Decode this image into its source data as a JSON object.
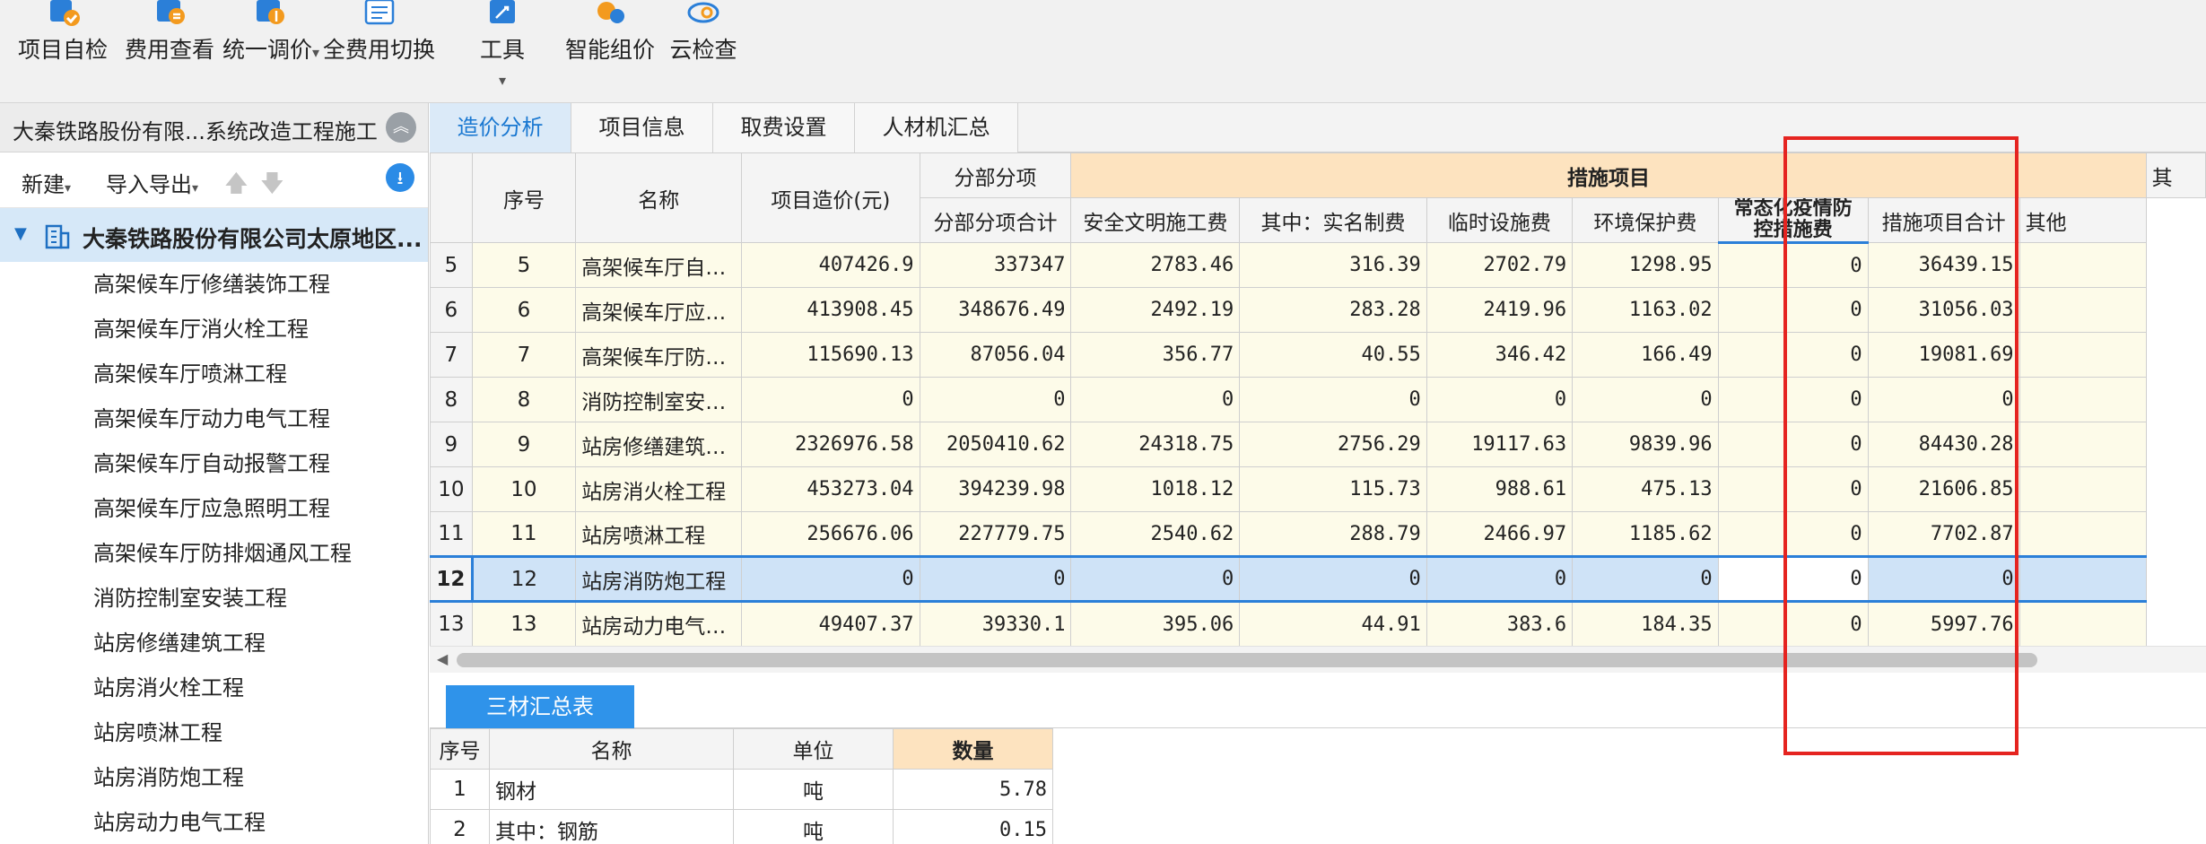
{
  "toolbar": {
    "items": [
      {
        "label": "项目自检",
        "icon": "project-check-icon"
      },
      {
        "label": "费用查看",
        "icon": "cost-view-icon"
      },
      {
        "label": "统一调价",
        "icon": "price-adjust-icon"
      },
      {
        "label": "全费用切换",
        "icon": "full-cost-switch-icon"
      },
      {
        "label": "工具",
        "icon": "tools-icon"
      },
      {
        "label": "智能组价",
        "icon": "smart-pricing-icon"
      },
      {
        "label": "云检查",
        "icon": "cloud-check-icon"
      }
    ]
  },
  "left": {
    "project_title": "大秦铁路股份有限...系统改造工程施工",
    "new_label": "新建",
    "import_export_label": "导入导出",
    "tree_root": "大秦铁路股份有限公司太原地区...",
    "tree_items": [
      "高架候车厅修缮装饰工程",
      "高架候车厅消火栓工程",
      "高架候车厅喷淋工程",
      "高架候车厅动力电气工程",
      "高架候车厅自动报警工程",
      "高架候车厅应急照明工程",
      "高架候车厅防排烟通风工程",
      "消防控制室安装工程",
      "站房修缮建筑工程",
      "站房消火栓工程",
      "站房喷淋工程",
      "站房消防炮工程",
      "站房动力电气工程"
    ]
  },
  "tabs": [
    "造价分析",
    "项目信息",
    "取费设置",
    "人材机汇总"
  ],
  "grid": {
    "headers": {
      "seq": "序号",
      "name": "名称",
      "cost": "项目造价(元)",
      "group_fbfx": "分部分项",
      "group_measures": "措施项目",
      "group_other": "其",
      "fbfx_total": "分部分项合计",
      "safety": "安全文明施工费",
      "realname": "其中：实名制费",
      "temp": "临时设施费",
      "env": "环境保护费",
      "epidemic_line1": "常态化疫情防",
      "epidemic_line2": "控措施费",
      "measures_total": "措施项目合计",
      "other": "其他"
    },
    "rows": [
      {
        "rownum": "5",
        "seq": "5",
        "name": "高架候车厅自…",
        "cost": "407426.9",
        "fbfx": "337347",
        "safety": "2783.46",
        "realname": "316.39",
        "temp": "2702.79",
        "env": "1298.95",
        "epidemic": "0",
        "measures": "36439.15"
      },
      {
        "rownum": "6",
        "seq": "6",
        "name": "高架候车厅应…",
        "cost": "413908.45",
        "fbfx": "348676.49",
        "safety": "2492.19",
        "realname": "283.28",
        "temp": "2419.96",
        "env": "1163.02",
        "epidemic": "0",
        "measures": "31056.03"
      },
      {
        "rownum": "7",
        "seq": "7",
        "name": "高架候车厅防…",
        "cost": "115690.13",
        "fbfx": "87056.04",
        "safety": "356.77",
        "realname": "40.55",
        "temp": "346.42",
        "env": "166.49",
        "epidemic": "0",
        "measures": "19081.69"
      },
      {
        "rownum": "8",
        "seq": "8",
        "name": "消防控制室安…",
        "cost": "0",
        "fbfx": "0",
        "safety": "0",
        "realname": "0",
        "temp": "0",
        "env": "0",
        "epidemic": "0",
        "measures": "0"
      },
      {
        "rownum": "9",
        "seq": "9",
        "name": "站房修缮建筑…",
        "cost": "2326976.58",
        "fbfx": "2050410.62",
        "safety": "24318.75",
        "realname": "2756.29",
        "temp": "19117.63",
        "env": "9839.96",
        "epidemic": "0",
        "measures": "84430.28"
      },
      {
        "rownum": "10",
        "seq": "10",
        "name": "站房消火栓工程",
        "cost": "453273.04",
        "fbfx": "394239.98",
        "safety": "1018.12",
        "realname": "115.73",
        "temp": "988.61",
        "env": "475.13",
        "epidemic": "0",
        "measures": "21606.85"
      },
      {
        "rownum": "11",
        "seq": "11",
        "name": "站房喷淋工程",
        "cost": "256676.06",
        "fbfx": "227779.75",
        "safety": "2540.62",
        "realname": "288.79",
        "temp": "2466.97",
        "env": "1185.62",
        "epidemic": "0",
        "measures": "7702.87"
      },
      {
        "rownum": "12",
        "seq": "12",
        "name": "站房消防炮工程",
        "cost": "0",
        "fbfx": "0",
        "safety": "0",
        "realname": "0",
        "temp": "0",
        "env": "0",
        "epidemic": "0",
        "measures": "0"
      },
      {
        "rownum": "13",
        "seq": "13",
        "name": "站房动力电气…",
        "cost": "49407.37",
        "fbfx": "39330.1",
        "safety": "395.06",
        "realname": "44.91",
        "temp": "383.6",
        "env": "184.35",
        "epidemic": "0",
        "measures": "5997.76"
      }
    ]
  },
  "bottom": {
    "tab_label": "三材汇总表",
    "headers": {
      "seq": "序号",
      "name": "名称",
      "unit": "单位",
      "qty": "数量"
    },
    "rows": [
      {
        "seq": "1",
        "name": "钢材",
        "unit": "吨",
        "qty": "5.78"
      },
      {
        "seq": "2",
        "name": "其中：钢筋",
        "unit": "吨",
        "qty": "0.15"
      }
    ]
  },
  "colors": {
    "accent": "#2b7fd8",
    "orange_header": "#fde3bf",
    "row_bg": "#fdfbe9",
    "selected_row": "#cfe3f7",
    "annotation": "#e52420"
  }
}
